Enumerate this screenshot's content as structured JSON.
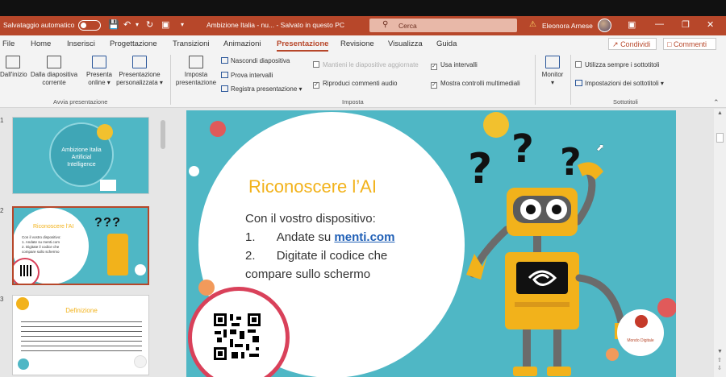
{
  "titlebar": {
    "autosave_label": "Salvataggio automatico",
    "doc_title": "Ambizione Italia - nu... - Salvato in questo PC",
    "search_placeholder": "Cerca",
    "user_name": "Eleonora Arnese"
  },
  "menu": {
    "tabs": [
      "File",
      "Home",
      "Inserisci",
      "Progettazione",
      "Transizioni",
      "Animazioni",
      "Presentazione",
      "Revisione",
      "Visualizza",
      "Guida"
    ],
    "active_tab": "Presentazione",
    "share_label": "Condividi",
    "comments_label": "Commenti"
  },
  "ribbon": {
    "start": {
      "from_start": "Dall'inizio",
      "from_current_1": "Dalla diapositiva",
      "from_current_2": "corrente",
      "present_online_1": "Presenta",
      "present_online_2": "online",
      "custom_1": "Presentazione",
      "custom_2": "personalizzata",
      "group_label": "Avvia presentazione"
    },
    "setup": {
      "setup_1": "Imposta",
      "setup_2": "presentazione",
      "hide_slide": "Nascondi diapositiva",
      "rehearse": "Prova intervalli",
      "record": "Registra presentazione",
      "keep_updated": "Mantieni le diapositive aggiornate",
      "play_narrations": "Riproduci commenti audio",
      "use_timings": "Usa intervalli",
      "show_media_controls": "Mostra controlli multimediali",
      "group_label": "Imposta"
    },
    "monitors": {
      "monitor_label": "Monitor"
    },
    "captions": {
      "always_use": "Utilizza sempre i sottotitoli",
      "settings": "Impostazioni dei sottotitoli",
      "group_label": "Sottotitoli"
    }
  },
  "thumbnails": [
    {
      "number": "1",
      "title_line1": "Ambizione Italia",
      "title_line2": "Artificial",
      "title_line3": "Intelligence"
    },
    {
      "number": "2",
      "title": "Riconoscere l'AI",
      "line1": "Con il vostro dispositivo:",
      "line2": "1. Andate su menti.com",
      "line3": "2. Digitate il codice che",
      "line4": "compare sullo schermo"
    },
    {
      "number": "3",
      "title": "Definizione"
    }
  ],
  "slide": {
    "title": "Riconoscere l’AI",
    "intro": "Con il vostro dispositivo:",
    "step1_num": "1.",
    "step1_text": "Andate su ",
    "step1_link": "menti.com",
    "step2_num": "2.",
    "step2_text": "Digitate il codice che",
    "step2_cont": "compare sullo schermo",
    "logo_text": "Mondo Digitale"
  },
  "colors": {
    "accent": "#b7472a",
    "slide_bg": "#4fb7c5",
    "title_yellow": "#f2b21b",
    "link_blue": "#1f5fb6"
  }
}
